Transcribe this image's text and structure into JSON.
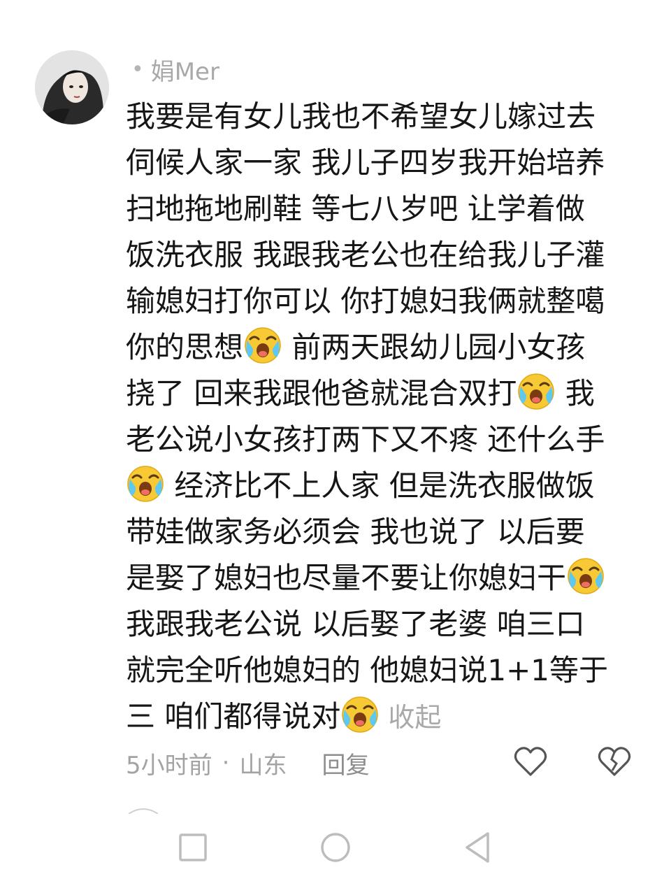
{
  "comment": {
    "username": "娟Mer",
    "lines": [
      [
        "我要是有女儿我也不希望女儿嫁过去"
      ],
      [
        "伺候人家一家 我儿子四岁我开始培养"
      ],
      [
        "扫地拖地刷鞋 等七八岁吧 让学着做"
      ],
      [
        "饭洗衣服 我跟我老公也在给我儿子灌"
      ],
      [
        "输媳妇打你可以 你打媳妇我俩就整噶"
      ],
      [
        "你的思想",
        "EMOJI",
        " 前两天跟幼儿园小女孩"
      ],
      [
        "挠了 回来我跟他爸就混合双打",
        "EMOJI",
        " 我"
      ],
      [
        "老公说小女孩打两下又不疼 还什么手"
      ],
      [
        "EMOJI",
        "  经济比不上人家 但是洗衣服做饭"
      ],
      [
        "带娃做家务必须会 我也说了 以后要"
      ],
      [
        "是娶了媳妇也尽量不要让你媳妇干",
        "EMOJI"
      ],
      [
        "我跟我老公说 以后娶了老婆 咱三口"
      ],
      [
        "就完全听他媳妇的 他媳妇说1+1等于"
      ],
      [
        "三 咱们都得说对",
        "EMOJI"
      ]
    ],
    "collapse_label": "收起",
    "emoji_name": "crying-laughing-emoji"
  },
  "meta": {
    "time": "5小时前",
    "separator": "·",
    "location": "山东",
    "reply_label": "回复"
  },
  "icons": {
    "like": "heart-outline-icon",
    "dislike": "broken-heart-icon",
    "nav": [
      "recent-apps-icon",
      "home-icon",
      "back-icon"
    ]
  },
  "colors": {
    "text": "#161616",
    "muted": "#a9a9a9",
    "emoji_face": "#f7c935"
  }
}
